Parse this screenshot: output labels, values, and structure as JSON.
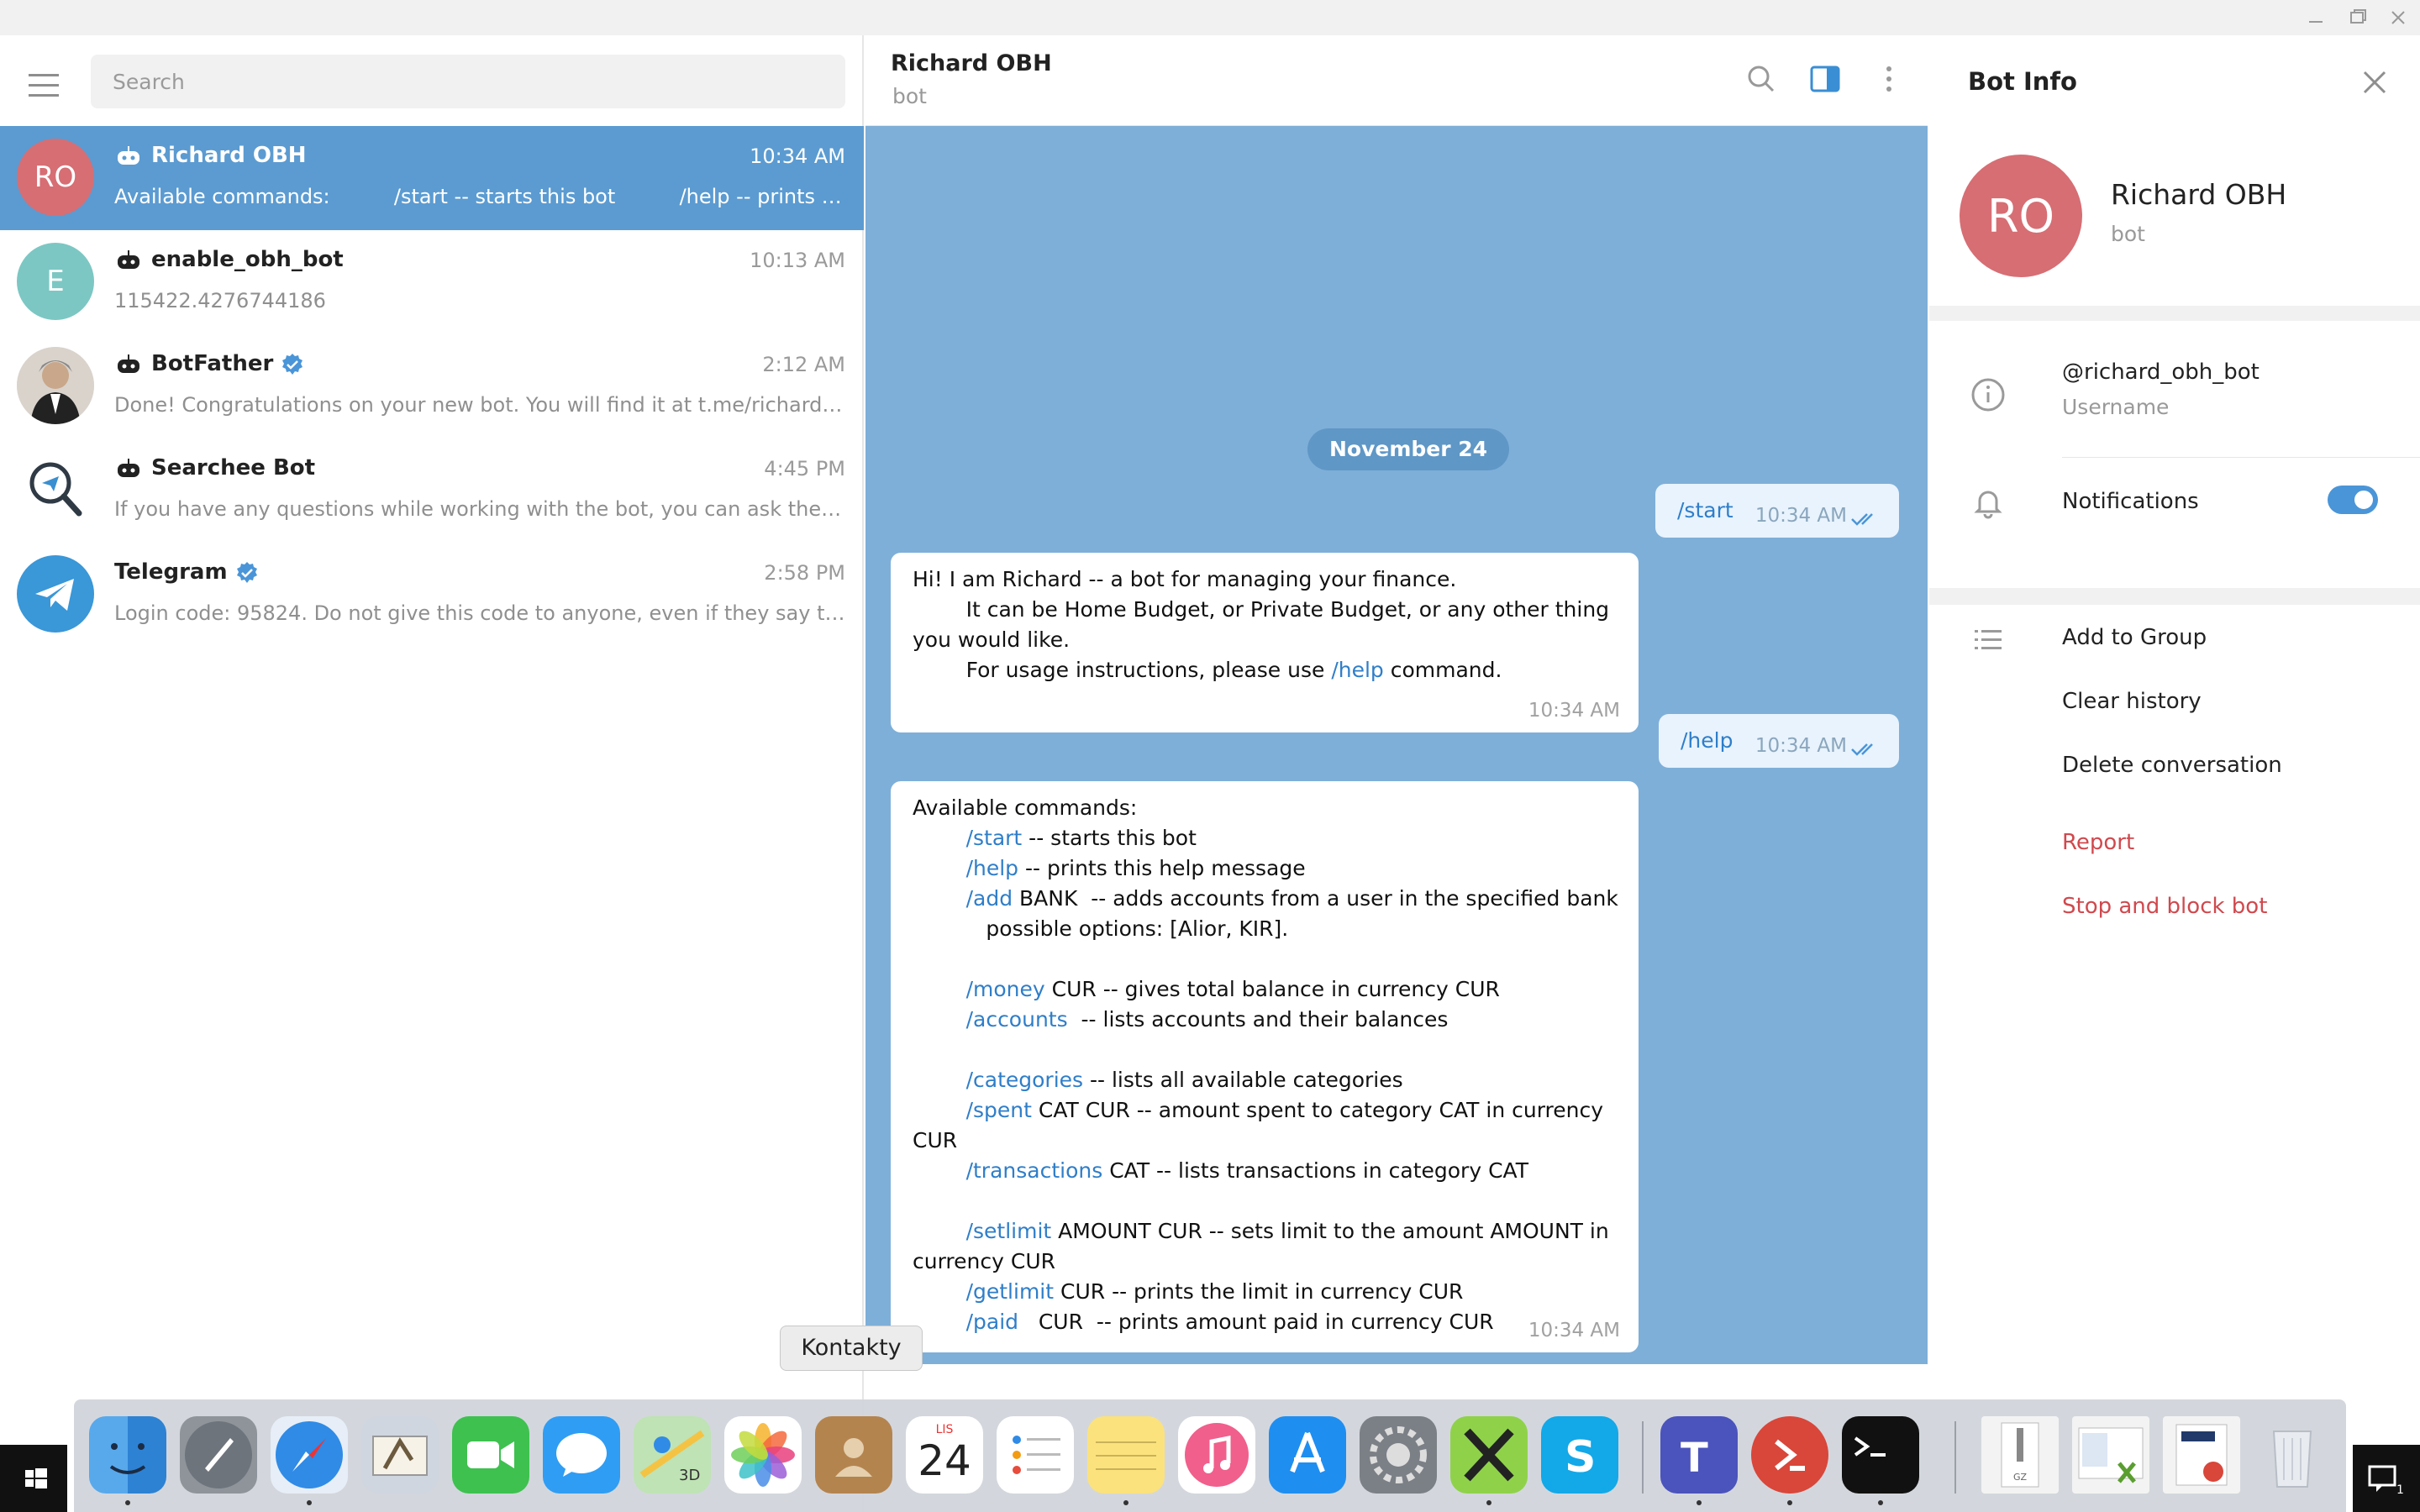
{
  "search": {
    "placeholder": "Search"
  },
  "chats": [
    {
      "initials": "RO",
      "name": "Richard OBH",
      "time": "10:34 AM",
      "preview": "Available commands:          /start -- starts this bot          /help -- prints t...",
      "color": "#d66e74",
      "active": true
    },
    {
      "initials": "E",
      "name": "enable_obh_bot",
      "time": "10:13 AM",
      "preview": "115422.4276744186",
      "color": "#7cc7c3"
    },
    {
      "initials": "",
      "name": "BotFather",
      "time": "2:12 AM",
      "preview": "Done! Congratulations on your new bot. You will find it at t.me/richard_...",
      "verified": true
    },
    {
      "initials": "",
      "name": "Searchee Bot",
      "time": "4:45 PM",
      "preview": "If you have any questions while working with the bot, you can ask them..."
    },
    {
      "initials": "",
      "name": "Telegram",
      "time": "2:58 PM",
      "preview": "Login code: 95824. Do not give this code to anyone, even if they say the...",
      "verified": true
    }
  ],
  "header": {
    "title": "Richard OBH",
    "subtitle": "bot"
  },
  "conversation": {
    "date": "November 24",
    "messages": [
      {
        "dir": "out",
        "text": "/start",
        "time": "10:34 AM"
      },
      {
        "dir": "in",
        "lines": [
          "Hi! I am Richard -- a bot for managing your finance.",
          "        It can be Home Budget, or Private Budget, or any other thing",
          "you would like.",
          "        For usage instructions, please use /help command."
        ],
        "time": "10:34 AM"
      },
      {
        "dir": "out",
        "text": "/help",
        "time": "10:34 AM"
      },
      {
        "dir": "in",
        "lines": [
          "Available commands:",
          "        /start -- starts this bot",
          "        /help -- prints this help message",
          "        /add BANK  -- adds accounts from a user in the specified bank",
          "           possible options: [Alior, KIR].",
          "",
          "        /money CUR -- gives total balance in currency CUR",
          "        /accounts  -- lists accounts and their balances",
          "",
          "        /categories -- lists all available categories",
          "        /spent CAT CUR -- amount spent to category CAT in currency",
          "CUR",
          "        /transactions CAT -- lists transactions in category CAT",
          "",
          "        /setlimit AMOUNT CUR -- sets limit to the amount AMOUNT in",
          "currency CUR",
          "        /getlimit CUR -- prints the limit in currency CUR",
          "        /paid   CUR  -- prints amount paid in currency CUR"
        ],
        "time": "10:34 AM"
      }
    ]
  },
  "info": {
    "title": "Bot Info",
    "initials": "RO",
    "name": "Richard OBH",
    "subtitle": "bot",
    "username": "@richard_obh_bot",
    "username_label": "Username",
    "notifications_label": "Notifications",
    "notifications_on": true,
    "actions": [
      "Add to Group",
      "Clear history",
      "Delete conversation"
    ],
    "danger": [
      "Report",
      "Stop and block bot"
    ]
  },
  "dock": {
    "tooltip": "Kontakty",
    "calendar_month": "LIS",
    "calendar_day": "24"
  },
  "colors": {
    "accent": "#5b9bd1",
    "chat_bg": "#7eafd8",
    "danger": "#d0494e"
  }
}
